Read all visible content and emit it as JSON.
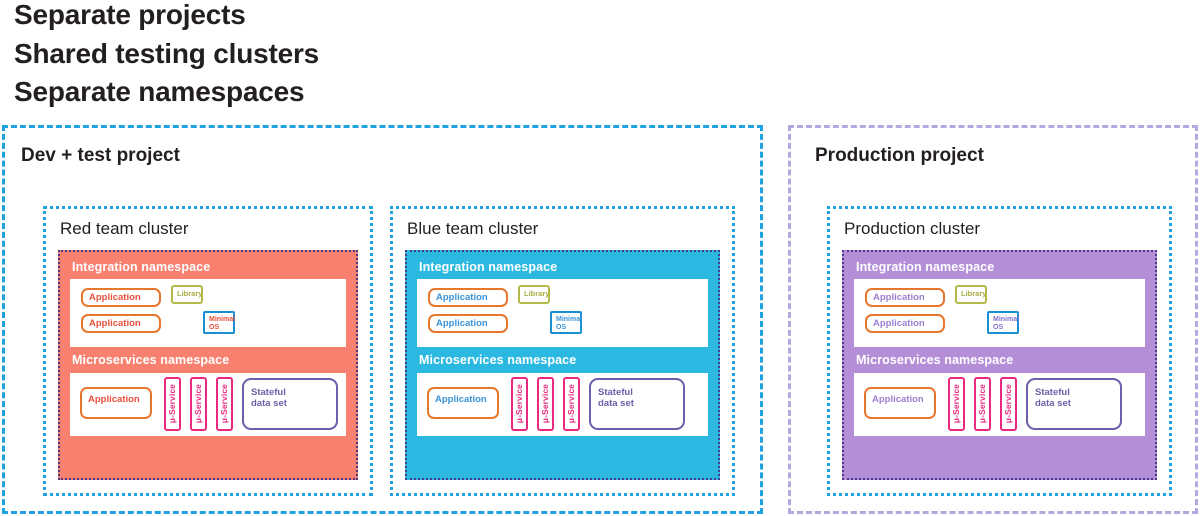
{
  "headings": [
    "Separate projects",
    "Shared testing clusters",
    "Separate namespaces"
  ],
  "colors": {
    "project_dev_border": "#1fa2e0",
    "project_prod_border": "#b3a8e0",
    "cluster_border": "#1fa2e0",
    "namespace_red": "#f8806f",
    "namespace_cyan": "#2bb9e2",
    "namespace_purple": "#b48fd8",
    "namespace_border": "#4a3a8c",
    "application_border": "#e8772e",
    "library_border": "#b3ba4a",
    "minimal_os_border": "#1b8fd4",
    "microservice_border": "#e9297f",
    "stateful_border": "#6a5fa8"
  },
  "labels": {
    "integration_namespace": "Integration namespace",
    "microservices_namespace": "Microservices namespace",
    "application": "Application",
    "library": "Library",
    "minimal_os_line1": "Minimal",
    "minimal_os_line2": "OS",
    "microservice": "μ-Service",
    "stateful_line1": "Stateful",
    "stateful_line2": "data set"
  },
  "projects": [
    {
      "title": "Dev + test project",
      "clusters": [
        {
          "title": "Red team cluster",
          "theme": "red"
        },
        {
          "title": "Blue team cluster",
          "theme": "blue"
        }
      ]
    },
    {
      "title": "Production project",
      "clusters": [
        {
          "title": "Production cluster",
          "theme": "purple"
        }
      ]
    }
  ]
}
